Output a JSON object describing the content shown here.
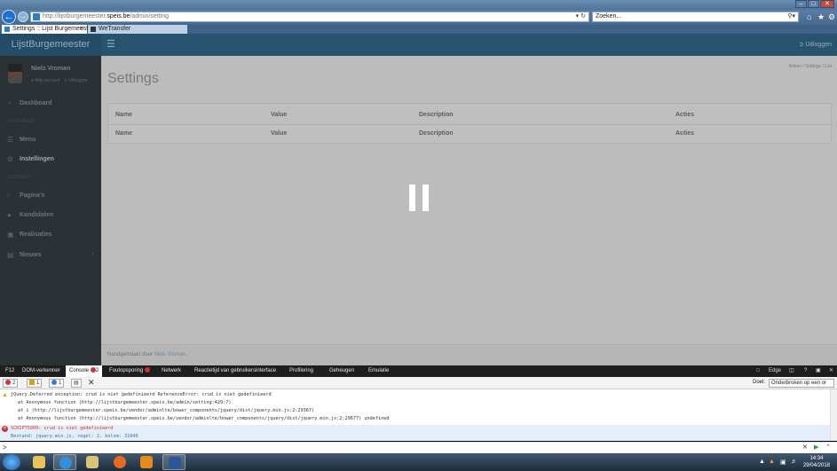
{
  "browser": {
    "window_controls": {
      "minimize": "–",
      "maximize": "□",
      "close": "✕"
    },
    "url_prefix": "http://lijstburgemeester.",
    "url_domain": "speis.be",
    "url_suffix": "/admin/setting",
    "search_placeholder": "Zoeken...",
    "tabs": [
      {
        "title": "Settings :: Lijst Burgemeeste...",
        "active": true
      },
      {
        "title": "WeTransfer",
        "active": false
      }
    ],
    "icons": [
      "back-arrow-icon",
      "forward-arrow-icon",
      "home-icon",
      "favorites-star-icon",
      "settings-gear-icon"
    ]
  },
  "app": {
    "brand": "LijstBurgemeester",
    "logout_top": "Uitloggen",
    "user": {
      "name": "Niels Vroman",
      "account_link": "Mijn account",
      "logout_link": "Uitloggen"
    },
    "sections": {
      "s1": "ALGEMEEN",
      "s2": "CONTENT"
    },
    "nav": [
      {
        "label": "Dashboard",
        "icon": "dashboard-icon"
      },
      {
        "label": "Menu",
        "icon": "list-icon"
      },
      {
        "label": "Instellingen",
        "icon": "gear-icon"
      },
      {
        "label": "Pagina's",
        "icon": "file-icon"
      },
      {
        "label": "Kandidaten",
        "icon": "user-icon"
      },
      {
        "label": "Realisaties",
        "icon": "book-icon"
      },
      {
        "label": "Nieuws",
        "icon": "newspaper-icon"
      }
    ],
    "breadcrumb": {
      "a": "Admin",
      "b": "Settings",
      "c": "List",
      "sep": "/"
    },
    "page_title": "Settings",
    "table": {
      "headers": [
        "Name",
        "Value",
        "Description",
        "Acties"
      ],
      "footer_row": [
        "Name",
        "Value",
        "Description",
        "Acties"
      ]
    },
    "footer": {
      "prefix": "Handgemaakt door ",
      "author": "Niels Vroman",
      "suffix": "."
    }
  },
  "devtools": {
    "f12": "F12",
    "tabs": [
      "DOM-verkenner",
      "Console",
      "Foutopsporing",
      "Netwerk",
      "Reactietijd van gebruikersinterface",
      "Profilering",
      "Geheugen",
      "Emulatie"
    ],
    "console_badge": "2",
    "right_mode": "Edge",
    "help": "?",
    "filters": {
      "errors": "2",
      "warnings": "1",
      "info": "1"
    },
    "target_label": "Doel:",
    "target_value": "Onderbroken op een or",
    "lines": [
      "jQuery.Deferred exception: crud is niet gedefinieerd ReferenceError: crud is niet gedefinieerd",
      "at Anonymous function (http://lijstburgemeester.speis.be/admin/setting:429:7)",
      "at i (http://lijstburgemeester.speis.be/vendor/adminlte/bower_components/jquery/dist/jquery.min.js:2:29367)",
      "at Anonymous function (http://lijstburgemeester.speis.be/vendor/adminlte/bower_components/jquery/dist/jquery.min.js:2:29677) undefined"
    ],
    "error_line": "SCRIPT5009: crud is niet gedefinieerd",
    "error_detail": "Bestand: jquery.min.js, regel: 2, kolom: 31040",
    "prompt": ">"
  },
  "taskbar": {
    "time": "14:34",
    "date": "29/04/2018"
  }
}
